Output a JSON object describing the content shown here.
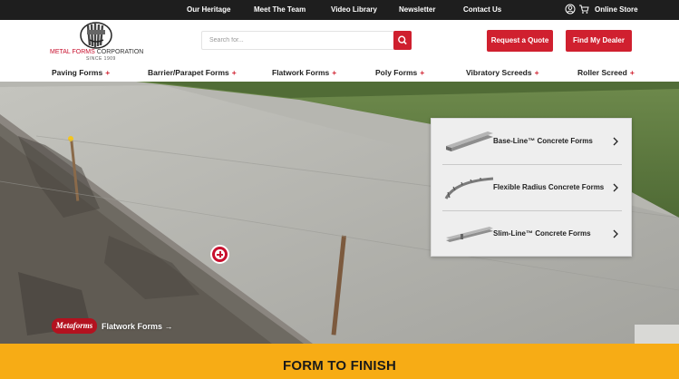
{
  "topbar": {
    "links": [
      "Our Heritage",
      "Meet The Team",
      "Video Library",
      "Newsletter",
      "Contact Us"
    ],
    "online_store": "Online Store",
    "icons": [
      "account-icon",
      "cart-icon"
    ]
  },
  "logo": {
    "name_left": "METAL FORMS",
    "name_right": "CORPORATION",
    "since_label": "SINCE",
    "since_year": "1909"
  },
  "search": {
    "placeholder": "Search for..."
  },
  "header_buttons": {
    "quote": "Request a Quote",
    "dealer": "Find My Dealer"
  },
  "nav": {
    "items": [
      "Paving Forms",
      "Barrier/Parapet Forms",
      "Flatwork Forms",
      "Poly Forms",
      "Vibratory Screeds",
      "Roller Screed"
    ],
    "plus": "+"
  },
  "hero": {
    "brand_badge": "Metaforms",
    "brand_link": "Flatwork Forms →"
  },
  "products": {
    "items": [
      {
        "label": "Base-Line™ Concrete Forms"
      },
      {
        "label": "Flexible Radius Concrete Forms"
      },
      {
        "label": "Slim-Line™ Concrete Forms"
      }
    ]
  },
  "banner": {
    "title": "FORM TO FINISH"
  },
  "colors": {
    "brand_red": "#d0202f",
    "topbar_bg": "#1e1e1e",
    "banner_yellow": "#f7ac15"
  }
}
